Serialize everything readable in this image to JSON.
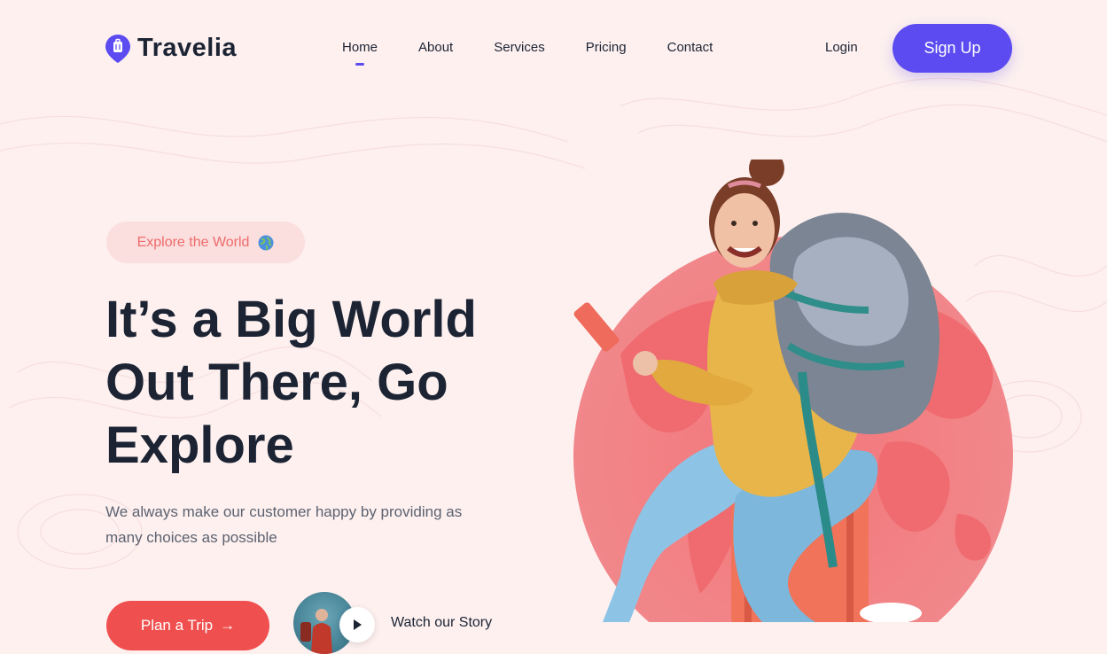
{
  "brand": {
    "name": "Travelia"
  },
  "nav": {
    "items": [
      {
        "label": "Home",
        "active": true
      },
      {
        "label": "About",
        "active": false
      },
      {
        "label": "Services",
        "active": false
      },
      {
        "label": "Pricing",
        "active": false
      },
      {
        "label": "Contact",
        "active": false
      }
    ],
    "login_label": "Login",
    "signup_label": "Sign Up"
  },
  "hero": {
    "badge_label": "Explore the World",
    "badge_icon": "globe-icon",
    "headline_line1": "It’s a Big World",
    "headline_line2": "Out There, Go",
    "headline_line3": "Explore",
    "subtext": "We always make our customer happy by providing as many choices as possible",
    "cta_label": "Plan a Trip",
    "watch_label": "Watch our Story"
  },
  "colors": {
    "background": "#fdf0ef",
    "accent_purple": "#5b4bf0",
    "accent_red": "#f04f4f",
    "globe_pink": "#f3767a",
    "text_dark": "#1c2434"
  }
}
